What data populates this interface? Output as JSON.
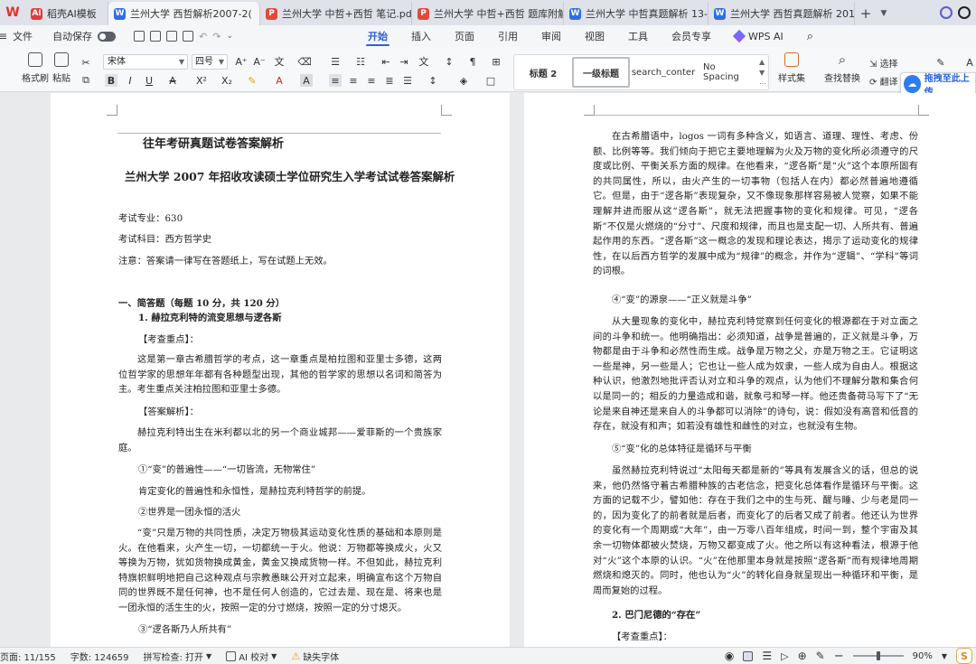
{
  "tabs": [
    {
      "label": "稻壳AI模板",
      "icon": "ai"
    },
    {
      "label": "兰州大学 西哲解析2007-2(",
      "icon": "w",
      "active": true
    },
    {
      "label": "兰州大学 中哲+西哲 笔记.pdf",
      "icon": "pdf"
    },
    {
      "label": "兰州大学 中哲+西哲 题库附解析.p",
      "icon": "pdf"
    },
    {
      "label": "兰州大学 中哲真题解析 13-21.do",
      "icon": "w"
    },
    {
      "label": "兰州大学 西哲真题解析 2013-20",
      "icon": "w"
    }
  ],
  "menubar": {
    "file": "文件",
    "autosave": "自动保存",
    "items": [
      "开始",
      "插入",
      "页面",
      "引用",
      "审阅",
      "视图",
      "工具",
      "会员专享",
      "WPS AI"
    ],
    "active": "开始"
  },
  "ribbon": {
    "format_painter": "格式刷",
    "paste": "粘贴",
    "font": "宋体",
    "font_size": "四号",
    "styles": [
      "标题 2",
      "一级标题",
      "search_conter",
      "No Spacing"
    ],
    "style_set": "样式集",
    "find_replace": "查找替换",
    "select": "选择",
    "translate": "翻译",
    "upload": "拖拽至此上传"
  },
  "left_page": {
    "header": "往年考研真题试卷答案解析",
    "title": "兰州大学 2007 年招收攻读硕士学位研究生入学考试试卷答案解析",
    "major": "考试专业：630",
    "subject": "考试科目：西方哲学史",
    "notice": "注意：答案请一律写在答题纸上，写在试题上无效。",
    "section": "一、简答题（每题 10 分，共 120 分）",
    "q1": "1. 赫拉克利特的流变思想与逻各斯",
    "key_label": "【考查重点】：",
    "key_para": "这是第一章古希腊哲学的考点，这一章重点是柏拉图和亚里士多德，这两位哲学家的思想年年都有各种题型出现，其他的哲学家的思想以名词和简答为主。考生重点关注柏拉图和亚里士多德。",
    "answer_label": "【答案解析】：",
    "answer_para": "赫拉克利特出生在米利都以北的另一个商业城邦——爱菲斯的一个贵族家庭。",
    "point1": "①“变”的普遍性——“一切皆流，无物常住”",
    "point1_para": "肯定变化的普遍性和永恒性，是赫拉克利特哲学的前提。",
    "point2": "②世界是一团永恒的活火",
    "point2_para": "“变”只是万物的共同性质，决定万物极其运动变化性质的基础和本原则是火。在他看来，火产生一切，一切都统一于火。他说：万物都等换成火，火又等换为万物，犹如货物换成黄金，黄金又换成货物一样。不但如此，赫拉克利特旗帜鲜明地把自己这种观点与宗教愚昧公开对立起来，明确宣布这个万物自同的世界既不是任何神，也不是任何人创造的，它过去是、现在是、将来也是一团永恒的活生生的火，按照一定的分寸燃烧，按照一定的分寸熄灭。",
    "point3": "③“逻各斯乃人所共有”"
  },
  "right_page": {
    "para1": "在古希腊语中，logos 一词有多种含义，如语言、道理、理性、考虑、份额、比例等等。我们倾向于把它主要地理解为火及万物的变化所必须遵守的尺度或比例、平衡关系方面的规律。在他看来，“逻各斯”是“火”这个本原所固有的共同属性，所以，由火产生的一切事物（包括人在内）都必然普遍地遵循它。但是，由于“逻各斯”表现复杂，又不像现象那样容易被人觉察，如果不能理解并进而服从这“逻各斯”，就无法把握事物的变化和规律。可见，“逻各斯”不仅是火燃烧的“分寸”、尺度和规律，而且也是支配一切、人所共有、普遍起作用的东西。“逻各斯”这一概念的发现和理论表达，揭示了运动变化的规律性，在以后西方哲学的发展中成为“规律”的概念，并作为“逻辑”、“学科”等词的词根。",
    "point4": "④“变”的源泉——“正义就是斗争”",
    "para2": "从大量现象的变化中，赫拉克利特觉察到任何变化的根源都在于对立面之间的斗争和统一。他明确指出：必须知道，战争是普遍的，正义就是斗争，万物都是由于斗争和必然性而生成。战争是万物之父，亦是万物之王。它证明这一些是神，另一些是人；它也让一些人成为奴隶，一些人成为自由人。根据这种认识，他激烈地批评否认对立和斗争的观点，认为他们不理解分散和集合何以是同一的；相反的力量造成和谐，就象弓和琴一样。他还贵备荷马写下了“无论是来自神还是来自人的斗争都可以消除”的诗句，说：假如没有高音和低音的存在，就没有和声；如若没有雄性和雌性的对立，也就没有生物。",
    "point5": "⑤“变”化的总体特征是循环与平衡",
    "para3": "虽然赫拉克利特说过“太阳每天都是新的”等具有发展含义的话，但总的说来，他仍然恪守着古希腊种族的古老信念，把变化总体看作是循环与平衡。这方面的记载不少，譬如他：存在于我们之中的生与死、醒与睡、少与老是同一的，因为变化了的前者就是后者，而变化了的后者又成了前者。他还认为世界的变化有一个周期或“大年”，由一万零八百年组成，时间一到，整个宇宙及其余一切物体都被火焚烧，万物又都变成了火。他之所以有这种看法，根源于他对“火”这个本原的认识。“火”在他那里本身就是按照“逻各斯”而有规律地周期燃烧和熄灭的。同时，他也认为“火”的转化自身就呈现出一种循环和平衡，是周而复始的过程。",
    "q2": "2. 巴门尼德的“存在”",
    "key_label": "【考查重点】："
  },
  "statusbar": {
    "page": "页面: 11/155",
    "words": "字数: 124659",
    "spell": "拼写检查: 打开",
    "ai_check": "AI 校对",
    "missing_font": "缺失字体",
    "zoom": "90%"
  }
}
